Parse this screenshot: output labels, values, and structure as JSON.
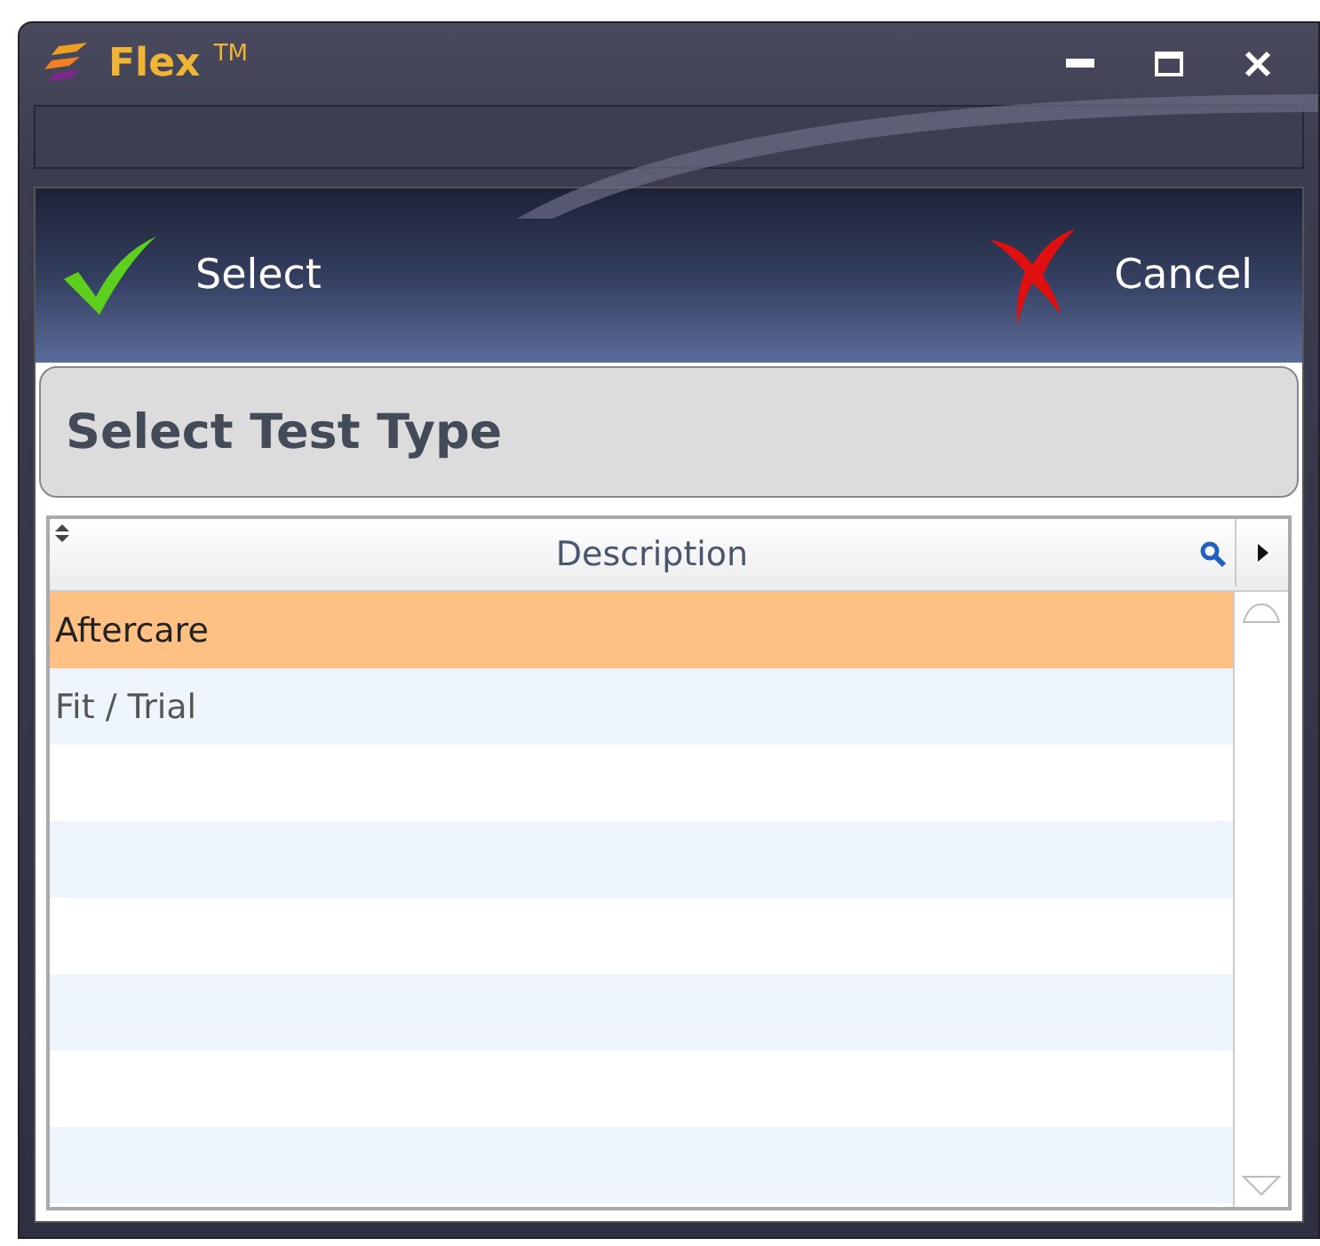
{
  "window": {
    "title": "Flex $^{TM}$"
  },
  "toolbar": {
    "select": "Select",
    "cancel": "Cancel"
  },
  "header": "Select Test Type",
  "table": {
    "columns": [
      {
        "label": "Description"
      }
    ],
    "rows": [
      {
        "description": "Aftercare",
        "selected": true
      },
      {
        "description": "Fit / Trial",
        "selected": false
      }
    ]
  }
}
